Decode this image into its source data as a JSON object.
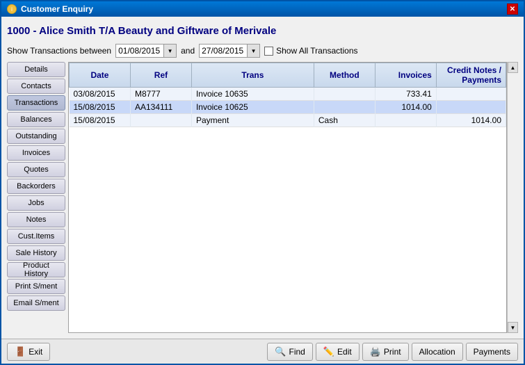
{
  "window": {
    "title": "Customer Enquiry",
    "close_label": "✕"
  },
  "main_title": "1000 - Alice Smith T/A Beauty and Giftware of Merivale",
  "date_row": {
    "label": "Show Transactions between",
    "date_from": "01/08/2015",
    "and_label": "and",
    "date_to": "27/08/2015",
    "show_all_label": "Show All Transactions"
  },
  "sidebar": {
    "buttons": [
      {
        "id": "details",
        "label": "Details"
      },
      {
        "id": "contacts",
        "label": "Contacts"
      },
      {
        "id": "transactions",
        "label": "Transactions",
        "active": true
      },
      {
        "id": "balances",
        "label": "Balances"
      },
      {
        "id": "outstanding",
        "label": "Outstanding"
      },
      {
        "id": "invoices",
        "label": "Invoices"
      },
      {
        "id": "quotes",
        "label": "Quotes"
      },
      {
        "id": "backorders",
        "label": "Backorders"
      },
      {
        "id": "jobs",
        "label": "Jobs"
      },
      {
        "id": "notes",
        "label": "Notes"
      },
      {
        "id": "cust-items",
        "label": "Cust.Items"
      },
      {
        "id": "sale-history",
        "label": "Sale History"
      },
      {
        "id": "product-history",
        "label": "Product History"
      },
      {
        "id": "print-sment",
        "label": "Print S/ment"
      },
      {
        "id": "email-sment",
        "label": "Email S/ment"
      }
    ]
  },
  "table": {
    "headers": [
      "Date",
      "Ref",
      "Trans",
      "Method",
      "Invoices",
      "Credit Notes /\nPayments"
    ],
    "rows": [
      {
        "date": "03/08/2015",
        "ref": "M8777",
        "trans": "Invoice 10635",
        "method": "",
        "invoices": "733.41",
        "credit": "",
        "selected": false
      },
      {
        "date": "15/08/2015",
        "ref": "AA134111",
        "trans": "Invoice 10625",
        "method": "",
        "invoices": "1014.00",
        "credit": "",
        "selected": true
      },
      {
        "date": "15/08/2015",
        "ref": "",
        "trans": "Payment",
        "method": "Cash",
        "invoices": "",
        "credit": "1014.00",
        "selected": false
      }
    ]
  },
  "bottom_buttons": {
    "exit": {
      "label": "Exit",
      "icon": "🚪"
    },
    "find": {
      "label": "Find",
      "icon": "🔍"
    },
    "edit": {
      "label": "Edit",
      "icon": "✏️"
    },
    "print": {
      "label": "Print",
      "icon": "🖨️"
    },
    "allocation": {
      "label": "Allocation"
    },
    "payments": {
      "label": "Payments"
    }
  }
}
